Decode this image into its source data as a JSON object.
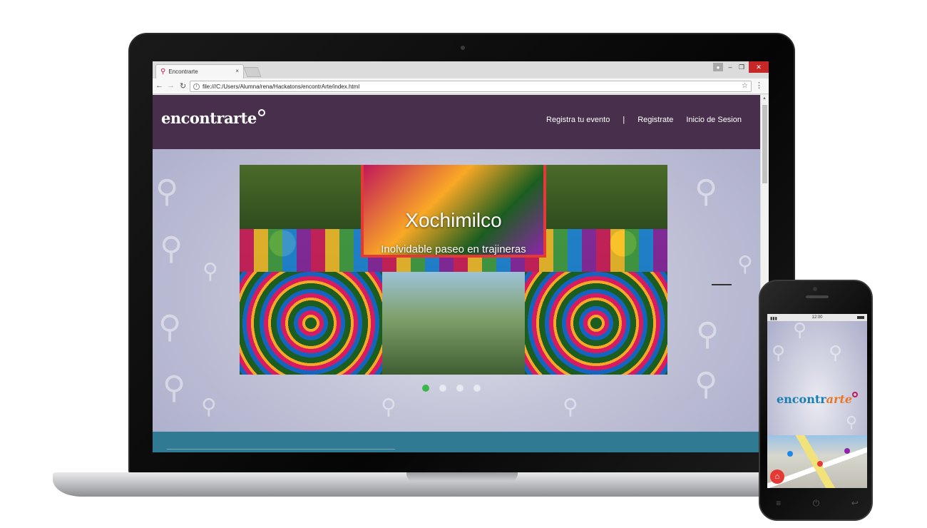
{
  "browser": {
    "tab_title": "Encontrarte",
    "tab_close": "×",
    "url": "file:///C:/Users/Alumna/rena/Hackatons/encontrArte/index.html",
    "window_controls": {
      "minimize": "–",
      "maximize": "❐",
      "close": "✕"
    }
  },
  "site": {
    "logo_text": "encontrarte",
    "nav": {
      "register_event": "Registra tu evento",
      "separator": "|",
      "register": "Registrate",
      "login": "Inicio de Sesion"
    },
    "hero": {
      "title": "Xochimilco",
      "subtitle": "Inolvidable paseo en trajineras"
    },
    "carousel": {
      "slide_count": 4,
      "active_index": 0
    },
    "colors": {
      "header": "#48304d",
      "footer": "#317a93",
      "active_dot": "#3cb54a"
    }
  },
  "phone": {
    "status_time": "12:00",
    "logo_part1": "encontr",
    "logo_part2": "arte",
    "home_icon": "home-icon"
  }
}
